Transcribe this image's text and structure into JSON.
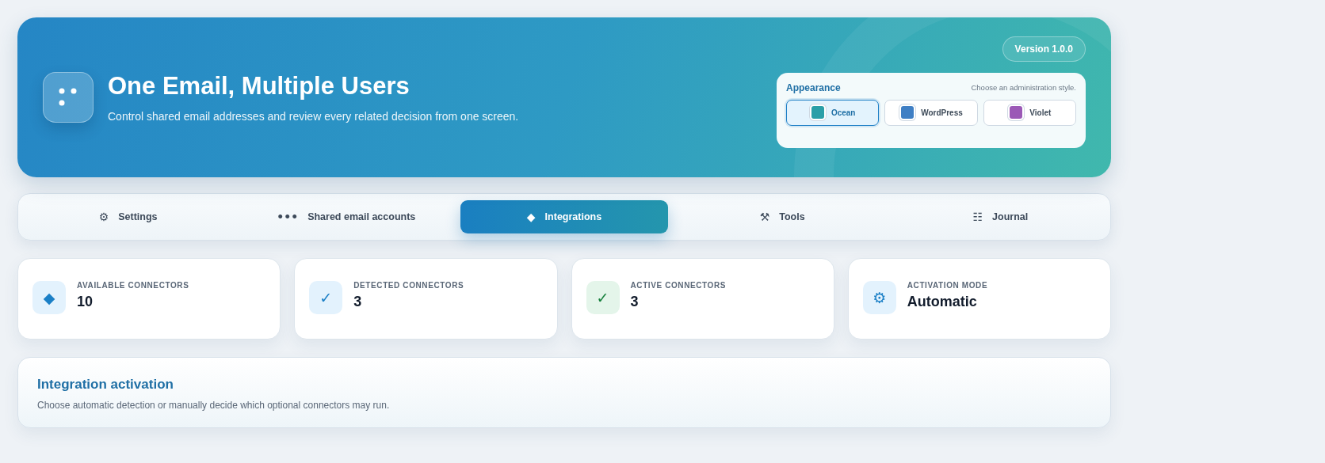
{
  "header": {
    "title": "One Email, Multiple Users",
    "subtitle": "Control shared email addresses and review every related decision from one screen.",
    "version": "Version 1.0.0",
    "appearance": {
      "title": "Appearance",
      "hint": "Choose an administration style.",
      "themes": [
        {
          "label": "Ocean",
          "selected": true,
          "color": "#2a9fa8"
        },
        {
          "label": "WordPress",
          "selected": false,
          "color": "#3f7fc4"
        },
        {
          "label": "Violet",
          "selected": false,
          "color": "#9b59b6"
        }
      ]
    }
  },
  "tabs": [
    {
      "icon": "⚙",
      "label": "Settings",
      "selected": false
    },
    {
      "icon": "•••",
      "label": "Shared email accounts",
      "selected": false
    },
    {
      "icon": "◆",
      "label": "Integrations",
      "selected": true
    },
    {
      "icon": "⚒",
      "label": "Tools",
      "selected": false
    },
    {
      "icon": "☷",
      "label": "Journal",
      "selected": false
    }
  ],
  "stats": [
    {
      "icon": "◆",
      "kind": "info",
      "label": "AVAILABLE CONNECTORS",
      "value": "10"
    },
    {
      "icon": "✓",
      "kind": "info",
      "label": "DETECTED CONNECTORS",
      "value": "3"
    },
    {
      "icon": "✓",
      "kind": "success",
      "label": "ACTIVE CONNECTORS",
      "value": "3"
    },
    {
      "icon": "⚙",
      "kind": "info",
      "label": "ACTIVATION MODE",
      "value": "Automatic"
    }
  ],
  "panel": {
    "title": "Integration activation",
    "description": "Choose automatic detection or manually decide which optional connectors may run."
  }
}
